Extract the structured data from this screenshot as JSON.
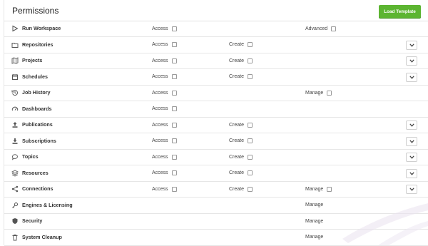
{
  "header": {
    "title": "Permissions",
    "load_template_label": "Load Template"
  },
  "rows": [
    {
      "icon": "play-icon",
      "label": "Run Workspace",
      "access": "Access",
      "create": "",
      "manage": "Advanced",
      "chevron": false
    },
    {
      "icon": "folder-icon",
      "label": "Repositories",
      "access": "Access",
      "create": "Create",
      "manage": "",
      "chevron": true
    },
    {
      "icon": "map-icon",
      "label": "Projects",
      "access": "Access",
      "create": "Create",
      "manage": "",
      "chevron": true
    },
    {
      "icon": "calendar-icon",
      "label": "Schedules",
      "access": "Access",
      "create": "Create",
      "manage": "",
      "chevron": true
    },
    {
      "icon": "history-icon",
      "label": "Job History",
      "access": "Access",
      "create": "",
      "manage": "Manage",
      "chevron": false
    },
    {
      "icon": "gauge-icon",
      "label": "Dashboards",
      "access": "Access",
      "create": "",
      "manage": "",
      "chevron": false
    },
    {
      "icon": "upload-icon",
      "label": "Publications",
      "access": "Access",
      "create": "Create",
      "manage": "",
      "chevron": true
    },
    {
      "icon": "download-icon",
      "label": "Subscriptions",
      "access": "Access",
      "create": "Create",
      "manage": "",
      "chevron": true
    },
    {
      "icon": "speech-bubble-icon",
      "label": "Topics",
      "access": "Access",
      "create": "Create",
      "manage": "",
      "chevron": true
    },
    {
      "icon": "layers-icon",
      "label": "Resources",
      "access": "Access",
      "create": "Create",
      "manage": "",
      "chevron": true
    },
    {
      "icon": "share-icon",
      "label": "Connections",
      "access": "Access",
      "create": "Create",
      "manage": "Manage",
      "chevron": true
    },
    {
      "icon": "key-icon",
      "label": "Engines & Licensing",
      "access": "",
      "create": "",
      "manage": "Manage",
      "chevron": false
    },
    {
      "icon": "shield-icon",
      "label": "Security",
      "access": "",
      "create": "",
      "manage": "Manage",
      "chevron": false
    },
    {
      "icon": "trash-icon",
      "label": "System Cleanup",
      "access": "",
      "create": "",
      "manage": "Manage",
      "chevron": false
    }
  ]
}
